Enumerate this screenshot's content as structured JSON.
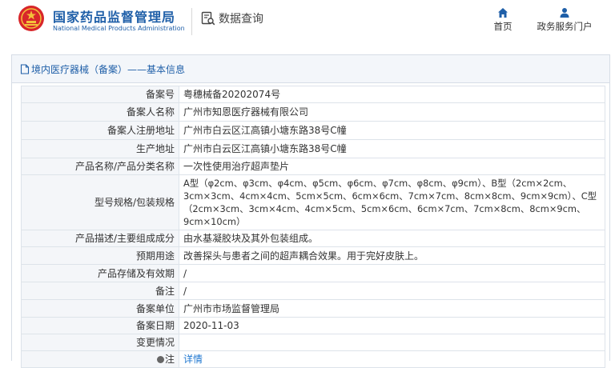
{
  "header": {
    "brand_cn": "国家药品监督管理局",
    "brand_en": "National Medical Products Administration",
    "query_label": "数据查询",
    "nav": [
      {
        "label": "首页",
        "icon": "home-icon"
      },
      {
        "label": "政务服务门户",
        "icon": "user-icon"
      }
    ]
  },
  "panel": {
    "title": "境内医疗器械（备案）——基本信息"
  },
  "rows": [
    {
      "label": "备案号",
      "value": "粤穗械备20202074号"
    },
    {
      "label": "备案人名称",
      "value": "广州市知恩医疗器械有限公司"
    },
    {
      "label": "备案人注册地址",
      "value": "广州市白云区江高镇小塘东路38号C幢"
    },
    {
      "label": "生产地址",
      "value": "广州市白云区江高镇小塘东路38号C幢"
    },
    {
      "label": "产品名称/产品分类名称",
      "value": "一次性使用治疗超声垫片"
    },
    {
      "label": "型号规格/包装规格",
      "value": "A型（φ2cm、φ3cm、φ4cm、φ5cm、φ6cm、φ7cm、φ8cm、φ9cm）、B型（2cm×2cm、3cm×3cm、4cm×4cm、5cm×5cm、6cm×6cm、7cm×7cm、8cm×8cm、9cm×9cm）、C型（2cm×3cm、3cm×4cm、4cm×5cm、5cm×6cm、6cm×7cm、7cm×8cm、8cm×9cm、9cm×10cm）"
    },
    {
      "label": "产品描述/主要组成成分",
      "value": "由水基凝胶块及其外包装组成。"
    },
    {
      "label": "预期用途",
      "value": "改善探头与患者之间的超声耦合效果。用于完好皮肤上。"
    },
    {
      "label": "产品存储及有效期",
      "value": "/"
    },
    {
      "label": "备注",
      "value": "/"
    },
    {
      "label": "备案单位",
      "value": "广州市市场监督管理局"
    },
    {
      "label": "备案日期",
      "value": "2020-11-03"
    },
    {
      "label": "变更情况",
      "value": ""
    }
  ],
  "note_row": {
    "label": "注",
    "value": "详情"
  },
  "colors": {
    "brand": "#1f5fa8",
    "link": "#1f77d0",
    "label_bg": "#f4f6f9"
  }
}
